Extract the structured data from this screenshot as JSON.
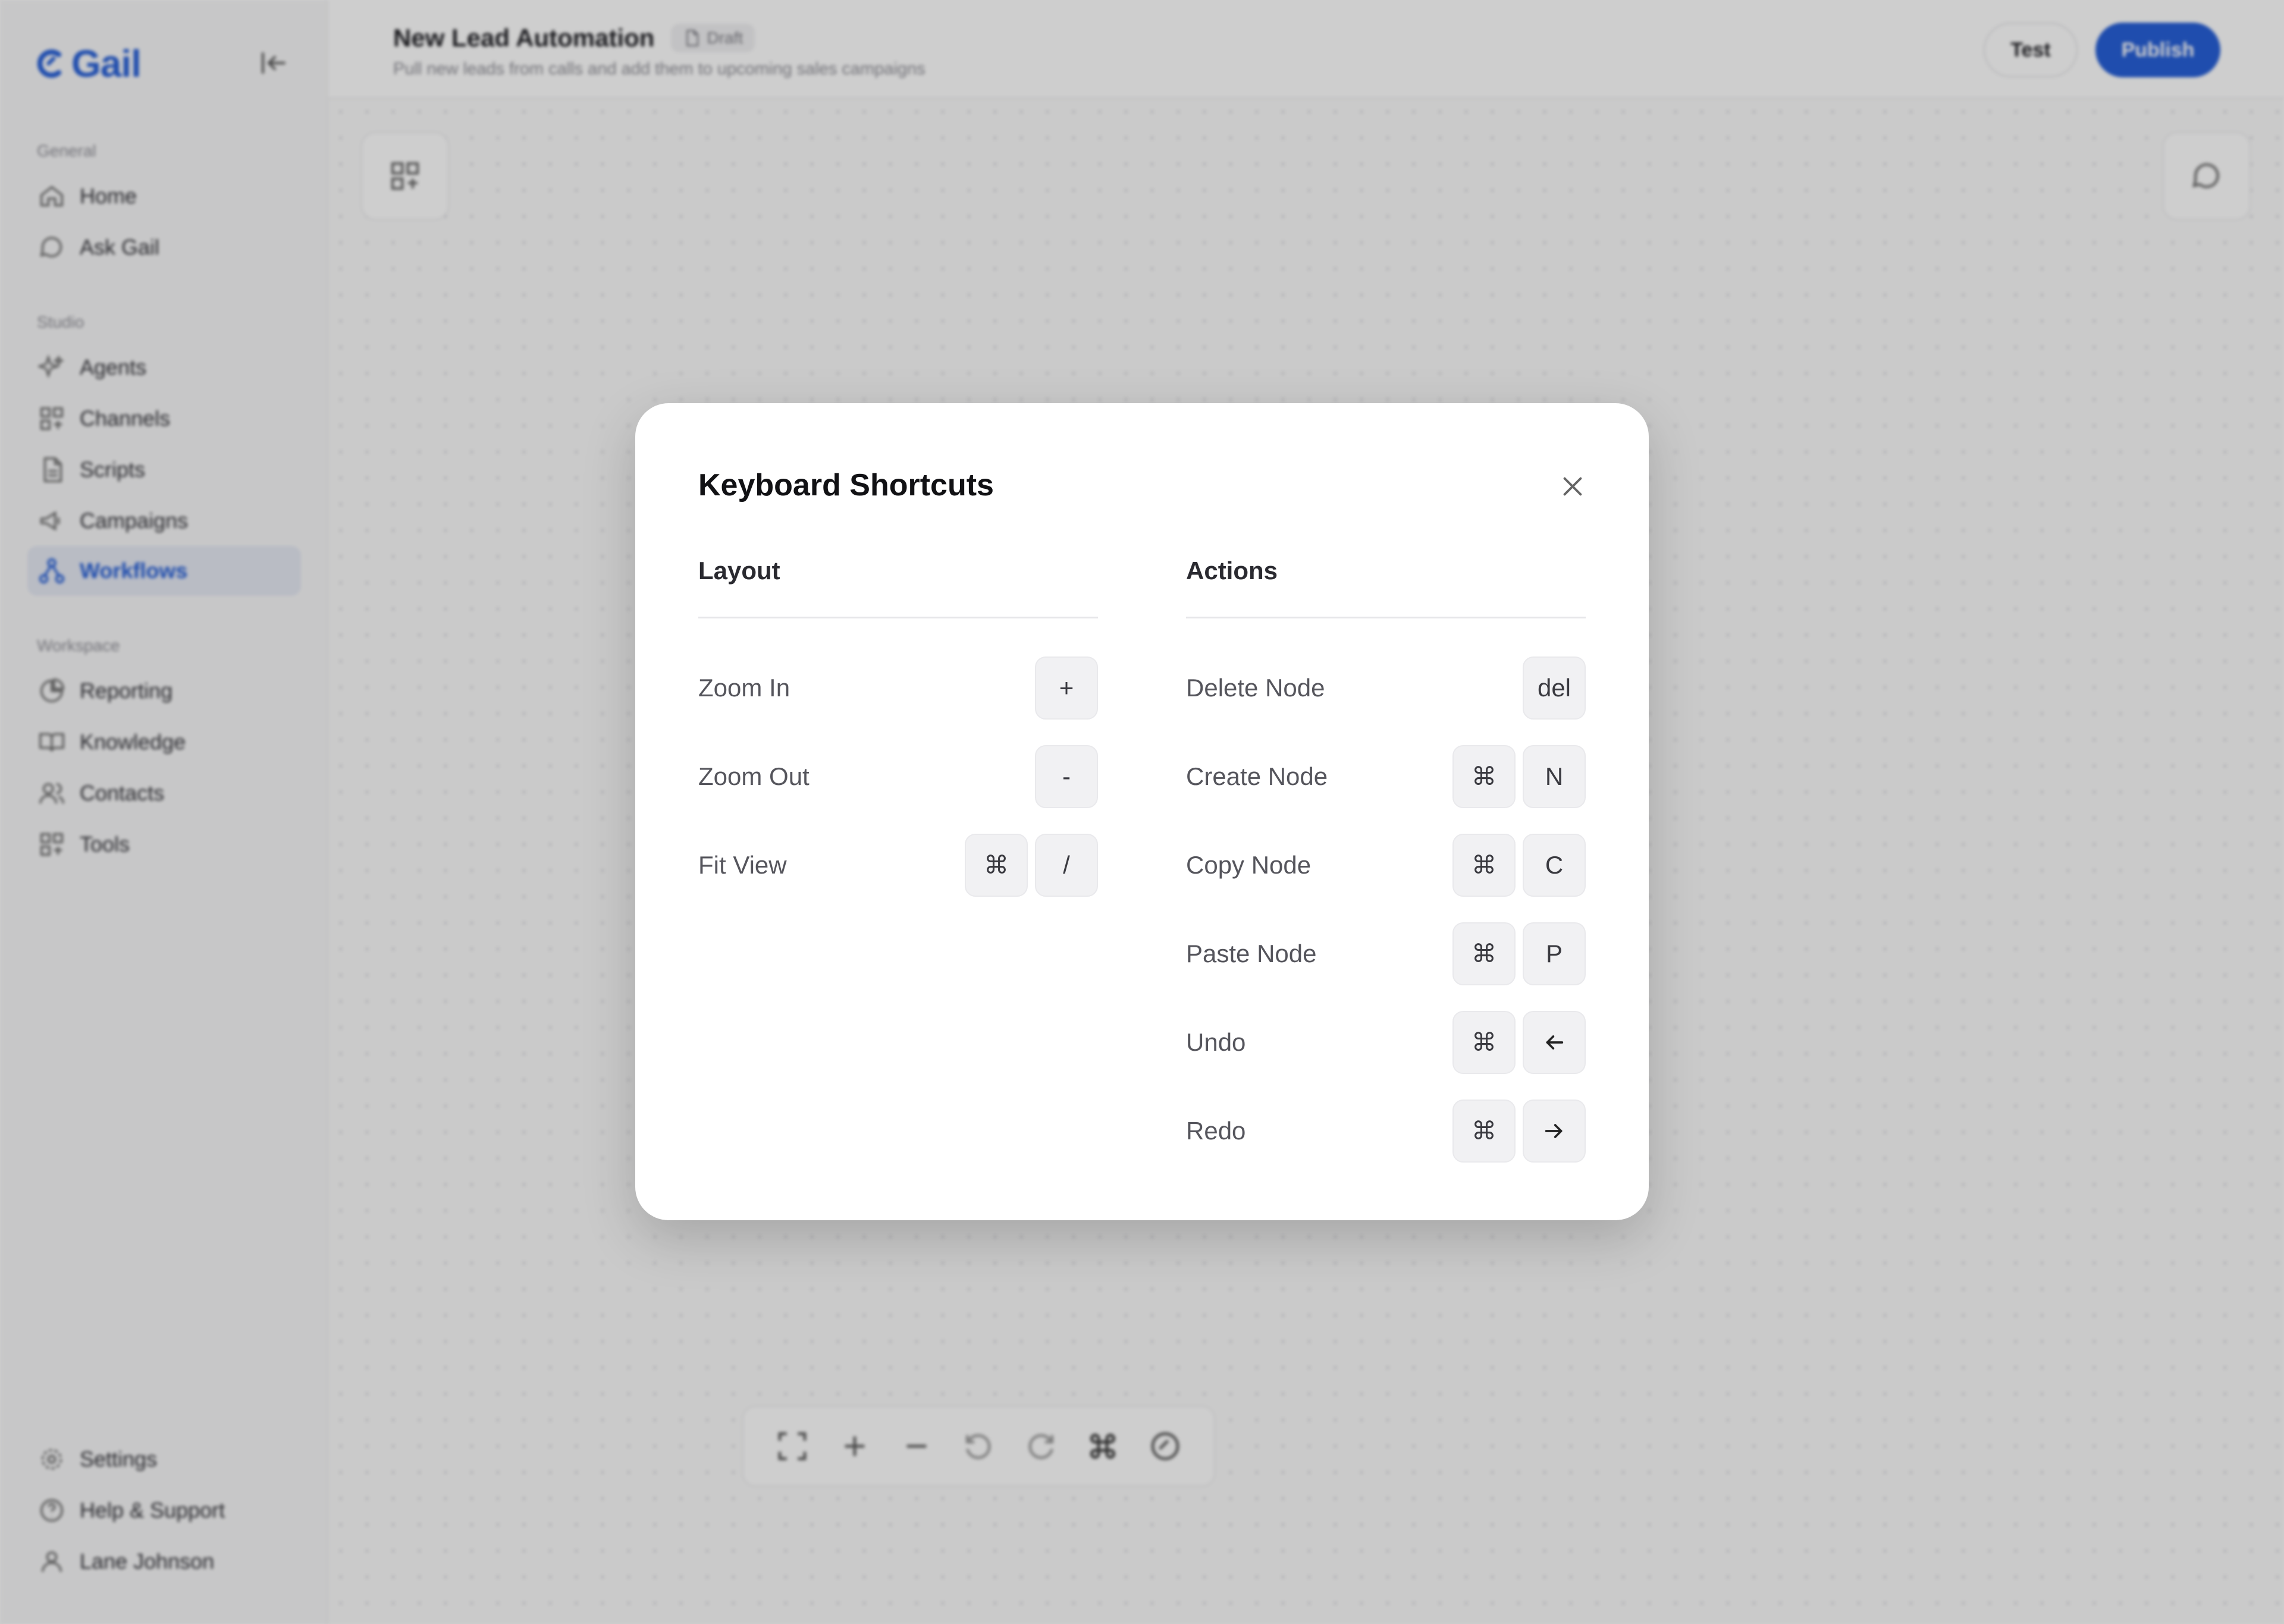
{
  "app": {
    "brand": "Gail"
  },
  "sidebar": {
    "sections": [
      {
        "title": "General",
        "items": [
          {
            "label": "Home",
            "icon": "home-icon"
          },
          {
            "label": "Ask Gail",
            "icon": "chat-icon"
          }
        ]
      },
      {
        "title": "Studio",
        "items": [
          {
            "label": "Agents",
            "icon": "sparkle-icon"
          },
          {
            "label": "Channels",
            "icon": "grid-icon"
          },
          {
            "label": "Scripts",
            "icon": "document-icon"
          },
          {
            "label": "Campaigns",
            "icon": "megaphone-icon"
          },
          {
            "label": "Workflows",
            "icon": "workflow-icon",
            "active": true
          }
        ]
      },
      {
        "title": "Workspace",
        "items": [
          {
            "label": "Reporting",
            "icon": "chart-icon"
          },
          {
            "label": "Knowledge",
            "icon": "book-icon"
          },
          {
            "label": "Contacts",
            "icon": "users-icon"
          },
          {
            "label": "Tools",
            "icon": "grid-icon"
          }
        ]
      }
    ],
    "footer": [
      {
        "label": "Settings",
        "icon": "gear-icon"
      },
      {
        "label": "Help & Support",
        "icon": "help-icon"
      },
      {
        "label": "Lane Johnson",
        "icon": "user-icon"
      }
    ]
  },
  "header": {
    "title": "New Lead Automation",
    "badge": "Draft",
    "subtitle": "Pull new leads from calls and add them to upcoming sales campaigns",
    "test_label": "Test",
    "publish_label": "Publish"
  },
  "modal": {
    "title": "Keyboard Shortcuts",
    "columns": [
      {
        "heading": "Layout",
        "rows": [
          {
            "label": "Zoom In",
            "keys": [
              "+"
            ]
          },
          {
            "label": "Zoom Out",
            "keys": [
              "-"
            ]
          },
          {
            "label": "Fit View",
            "keys": [
              "⌘",
              "/"
            ]
          }
        ]
      },
      {
        "heading": "Actions",
        "rows": [
          {
            "label": "Delete Node",
            "keys": [
              "del"
            ]
          },
          {
            "label": "Create Node",
            "keys": [
              "⌘",
              "N"
            ]
          },
          {
            "label": "Copy Node",
            "keys": [
              "⌘",
              "C"
            ]
          },
          {
            "label": "Paste Node",
            "keys": [
              "⌘",
              "P"
            ]
          },
          {
            "label": "Undo",
            "keys": [
              "⌘",
              "arrow-left-icon"
            ]
          },
          {
            "label": "Redo",
            "keys": [
              "⌘",
              "arrow-right-icon"
            ]
          }
        ]
      }
    ]
  },
  "colors": {
    "accent": "#1f5ad6",
    "modal_bg": "#ffffff",
    "key_bg": "#f1f1f3"
  }
}
